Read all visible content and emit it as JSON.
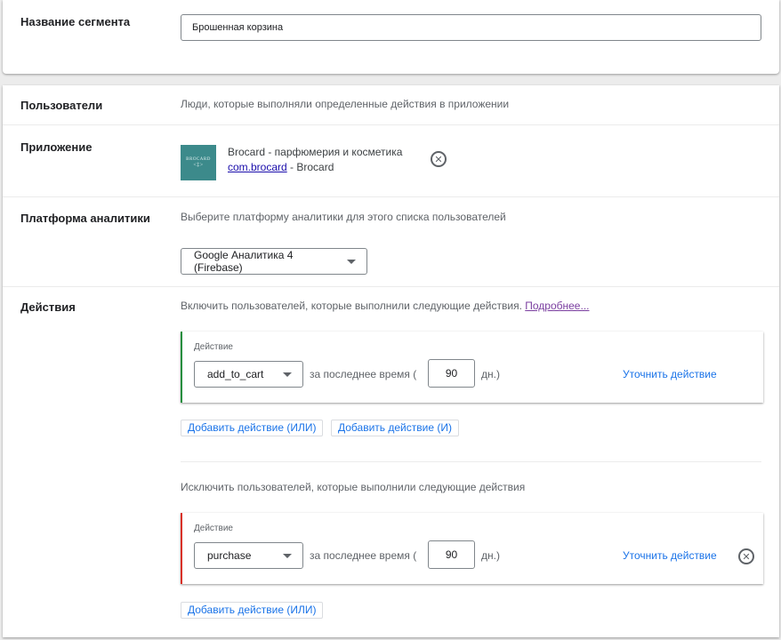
{
  "segment": {
    "label": "Название сегмента",
    "value": "Брошенная корзина"
  },
  "users": {
    "label": "Пользователи",
    "description": "Люди, которые выполняли определенные действия в приложении"
  },
  "app": {
    "label": "Приложение",
    "icon_text": "BROCARD",
    "icon_subtext": "<‡>",
    "name": "Brocard - парфюмерия и косметика",
    "package": "com.brocard",
    "publisher": " - Brocard",
    "remove_icon": "circle-x-icon"
  },
  "analytics": {
    "label": "Платформа аналитики",
    "description": "Выберите платформу аналитики для этого списка пользователей",
    "platform": "Google Аналитика 4 (Firebase)"
  },
  "actions": {
    "label": "Действия",
    "include_text": "Включить пользователей, которые выполнили следующие действия.",
    "learn_more": "Подробнее...",
    "include_action": {
      "label": "Действие",
      "event": "add_to_cart",
      "time_text": "за последнее время (",
      "days": "90",
      "days_suffix": "дн.)",
      "refine": "Уточнить действие"
    },
    "add_or": "Добавить действие (ИЛИ)",
    "add_and": "Добавить действие (И)",
    "exclude_text": "Исключить пользователей, которые выполнили следующие действия",
    "exclude_action": {
      "label": "Действие",
      "event": "purchase",
      "time_text": "за последнее время (",
      "days": "90",
      "days_suffix": "дн.)",
      "refine": "Уточнить действие"
    },
    "exclude_add_or": "Добавить действие (ИЛИ)"
  },
  "colors": {
    "include_accent": "#1e8e3e",
    "exclude_accent": "#d93025",
    "link": "#1a73e8",
    "app_icon_bg": "#3c8a8b"
  }
}
